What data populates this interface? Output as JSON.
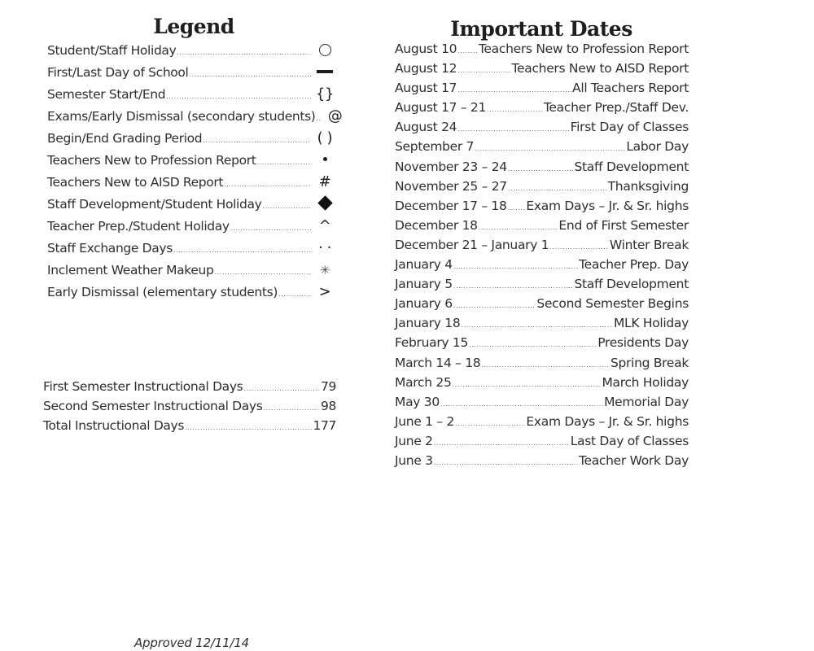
{
  "legend": {
    "title": "Legend",
    "items": [
      {
        "label": "Student/Staff Holiday",
        "symbol": "circle-outline",
        "glyph": ""
      },
      {
        "label": "First/Last Day of School",
        "symbol": "bar",
        "glyph": ""
      },
      {
        "label": "Semester Start/End",
        "symbol": "braces",
        "glyph": "{}"
      },
      {
        "label": "Exams/Early Dismissal (secondary students)",
        "symbol": "at-sign",
        "glyph": "@"
      },
      {
        "label": "Begin/End Grading Period",
        "symbol": "parentheses",
        "glyph": "( )"
      },
      {
        "label": "Teachers New to Profession Report",
        "symbol": "bullet",
        "glyph": ""
      },
      {
        "label": "Teachers New to AISD Report",
        "symbol": "hash",
        "glyph": "#"
      },
      {
        "label": "Staff Development/Student Holiday",
        "symbol": "diamond-filled",
        "glyph": ""
      },
      {
        "label": "Teacher Prep./Student Holiday",
        "symbol": "caret",
        "glyph": "^"
      },
      {
        "label": "Staff Exchange Days",
        "symbol": "two-dots",
        "glyph": "· ·"
      },
      {
        "label": "Inclement Weather Makeup",
        "symbol": "asterisk",
        "glyph": "✳"
      },
      {
        "label": "Early Dismissal (elementary students)",
        "symbol": "greater-than",
        "glyph": ">"
      }
    ]
  },
  "instructional_days": [
    {
      "label": "First Semester Instructional Days",
      "value": "79"
    },
    {
      "label": "Second Semester Instructional Days",
      "value": "98"
    },
    {
      "label": "Total Instructional Days",
      "value": "177"
    }
  ],
  "important_dates": {
    "title": "Important Dates",
    "items": [
      {
        "date": "August 10",
        "event": "Teachers New to Profession Report"
      },
      {
        "date": "August 12",
        "event": "Teachers New to AISD Report"
      },
      {
        "date": "August 17",
        "event": "All Teachers Report"
      },
      {
        "date": "August 17 – 21",
        "event": "Teacher Prep./Staff Dev."
      },
      {
        "date": "August 24",
        "event": "First Day of Classes"
      },
      {
        "date": "September 7",
        "event": "Labor Day"
      },
      {
        "date": "November 23 – 24",
        "event": "Staff Development"
      },
      {
        "date": "November 25 – 27",
        "event": "Thanksgiving"
      },
      {
        "date": "December 17 – 18",
        "event": "Exam Days – Jr. & Sr. highs"
      },
      {
        "date": "December 18",
        "event": "End of First Semester"
      },
      {
        "date": "December 21 – January 1",
        "event": "Winter Break"
      },
      {
        "date": "January 4",
        "event": "Teacher Prep. Day"
      },
      {
        "date": "January 5",
        "event": "Staff Development"
      },
      {
        "date": "January 6",
        "event": "Second Semester Begins"
      },
      {
        "date": "January 18",
        "event": "MLK Holiday"
      },
      {
        "date": "February 15",
        "event": "Presidents Day"
      },
      {
        "date": "March 14 – 18",
        "event": "Spring Break"
      },
      {
        "date": "March 25",
        "event": "March Holiday"
      },
      {
        "date": "May 30",
        "event": "Memorial Day"
      },
      {
        "date": "June 1 – 2",
        "event": "Exam Days – Jr. & Sr. highs"
      },
      {
        "date": "June 2",
        "event": "Last Day of Classes"
      },
      {
        "date": "June 3",
        "event": "Teacher Work Day"
      }
    ]
  },
  "footer": {
    "approved": "Approved 12/11/14"
  }
}
